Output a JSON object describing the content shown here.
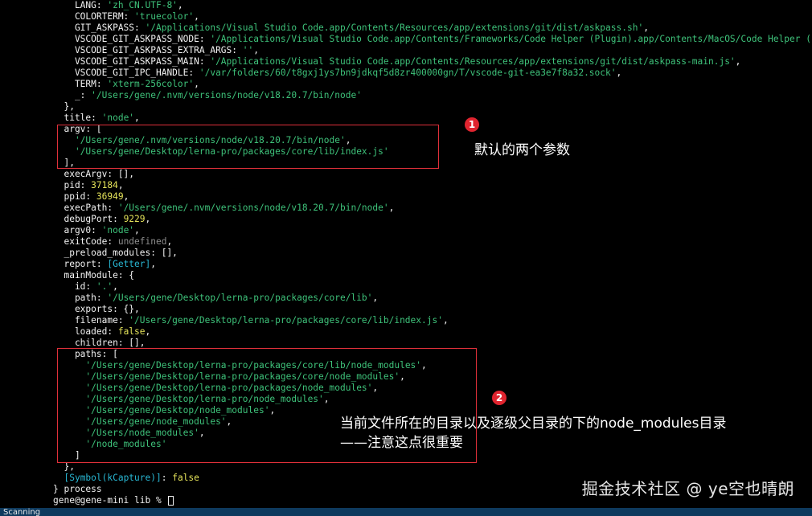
{
  "terminal": {
    "lines": [
      [
        {
          "t": "    LANG: ",
          "c": "k"
        },
        {
          "t": "'zh_CN.UTF-8'",
          "c": "s"
        },
        {
          "t": ",",
          "c": "p"
        }
      ],
      [
        {
          "t": "    COLORTERM: ",
          "c": "k"
        },
        {
          "t": "'truecolor'",
          "c": "s"
        },
        {
          "t": ",",
          "c": "p"
        }
      ],
      [
        {
          "t": "    GIT_ASKPASS: ",
          "c": "k"
        },
        {
          "t": "'/Applications/Visual Studio Code.app/Contents/Resources/app/extensions/git/dist/askpass.sh'",
          "c": "s"
        },
        {
          "t": ",",
          "c": "p"
        }
      ],
      [
        {
          "t": "    VSCODE_GIT_ASKPASS_NODE: ",
          "c": "k"
        },
        {
          "t": "'/Applications/Visual Studio Code.app/Contents/Frameworks/Code Helper (Plugin).app/Contents/MacOS/Code Helper (Plugin)'",
          "c": "s"
        },
        {
          "t": ",",
          "c": "p"
        }
      ],
      [
        {
          "t": "    VSCODE_GIT_ASKPASS_EXTRA_ARGS: ",
          "c": "k"
        },
        {
          "t": "''",
          "c": "s"
        },
        {
          "t": ",",
          "c": "p"
        }
      ],
      [
        {
          "t": "    VSCODE_GIT_ASKPASS_MAIN: ",
          "c": "k"
        },
        {
          "t": "'/Applications/Visual Studio Code.app/Contents/Resources/app/extensions/git/dist/askpass-main.js'",
          "c": "s"
        },
        {
          "t": ",",
          "c": "p"
        }
      ],
      [
        {
          "t": "    VSCODE_GIT_IPC_HANDLE: ",
          "c": "k"
        },
        {
          "t": "'/var/folders/60/t8gxj1ys7bn9jdkqf5d8zr400000gn/T/vscode-git-ea3e7f8a32.sock'",
          "c": "s"
        },
        {
          "t": ",",
          "c": "p"
        }
      ],
      [
        {
          "t": "    TERM: ",
          "c": "k"
        },
        {
          "t": "'xterm-256color'",
          "c": "s"
        },
        {
          "t": ",",
          "c": "p"
        }
      ],
      [
        {
          "t": "    _: ",
          "c": "k"
        },
        {
          "t": "'/Users/gene/.nvm/versions/node/v18.20.7/bin/node'",
          "c": "s"
        }
      ],
      [
        {
          "t": "  },",
          "c": "p"
        }
      ],
      [
        {
          "t": "  title: ",
          "c": "k"
        },
        {
          "t": "'node'",
          "c": "s"
        },
        {
          "t": ",",
          "c": "p"
        }
      ],
      [
        {
          "t": "  argv: [",
          "c": "k"
        }
      ],
      [
        {
          "t": "    ",
          "c": "p"
        },
        {
          "t": "'/Users/gene/.nvm/versions/node/v18.20.7/bin/node'",
          "c": "s"
        },
        {
          "t": ",",
          "c": "p"
        }
      ],
      [
        {
          "t": "    ",
          "c": "p"
        },
        {
          "t": "'/Users/gene/Desktop/lerna-pro/packages/core/lib/index.js'",
          "c": "s"
        }
      ],
      [
        {
          "t": "  ],",
          "c": "p"
        }
      ],
      [
        {
          "t": "  execArgv: [],",
          "c": "k"
        }
      ],
      [
        {
          "t": "  pid: ",
          "c": "k"
        },
        {
          "t": "37184",
          "c": "n"
        },
        {
          "t": ",",
          "c": "p"
        }
      ],
      [
        {
          "t": "  ppid: ",
          "c": "k"
        },
        {
          "t": "36949",
          "c": "n"
        },
        {
          "t": ",",
          "c": "p"
        }
      ],
      [
        {
          "t": "  execPath: ",
          "c": "k"
        },
        {
          "t": "'/Users/gene/.nvm/versions/node/v18.20.7/bin/node'",
          "c": "s"
        },
        {
          "t": ",",
          "c": "p"
        }
      ],
      [
        {
          "t": "  debugPort: ",
          "c": "k"
        },
        {
          "t": "9229",
          "c": "n"
        },
        {
          "t": ",",
          "c": "p"
        }
      ],
      [
        {
          "t": "  argv0: ",
          "c": "k"
        },
        {
          "t": "'node'",
          "c": "s"
        },
        {
          "t": ",",
          "c": "p"
        }
      ],
      [
        {
          "t": "  exitCode: ",
          "c": "k"
        },
        {
          "t": "undefined",
          "c": "u"
        },
        {
          "t": ",",
          "c": "p"
        }
      ],
      [
        {
          "t": "  _preload_modules: [],",
          "c": "k"
        }
      ],
      [
        {
          "t": "  report: ",
          "c": "k"
        },
        {
          "t": "[Getter]",
          "c": "c"
        },
        {
          "t": ",",
          "c": "p"
        }
      ],
      [
        {
          "t": "  mainModule: {",
          "c": "k"
        }
      ],
      [
        {
          "t": "    id: ",
          "c": "k"
        },
        {
          "t": "'.'",
          "c": "s"
        },
        {
          "t": ",",
          "c": "p"
        }
      ],
      [
        {
          "t": "    path: ",
          "c": "k"
        },
        {
          "t": "'/Users/gene/Desktop/lerna-pro/packages/core/lib'",
          "c": "s"
        },
        {
          "t": ",",
          "c": "p"
        }
      ],
      [
        {
          "t": "    exports: {},",
          "c": "k"
        }
      ],
      [
        {
          "t": "    filename: ",
          "c": "k"
        },
        {
          "t": "'/Users/gene/Desktop/lerna-pro/packages/core/lib/index.js'",
          "c": "s"
        },
        {
          "t": ",",
          "c": "p"
        }
      ],
      [
        {
          "t": "    loaded: ",
          "c": "k"
        },
        {
          "t": "false",
          "c": "n"
        },
        {
          "t": ",",
          "c": "p"
        }
      ],
      [
        {
          "t": "    children: [],",
          "c": "k"
        }
      ],
      [
        {
          "t": "    paths: [",
          "c": "k"
        }
      ],
      [
        {
          "t": "      ",
          "c": "p"
        },
        {
          "t": "'/Users/gene/Desktop/lerna-pro/packages/core/lib/node_modules'",
          "c": "s"
        },
        {
          "t": ",",
          "c": "p"
        }
      ],
      [
        {
          "t": "      ",
          "c": "p"
        },
        {
          "t": "'/Users/gene/Desktop/lerna-pro/packages/core/node_modules'",
          "c": "s"
        },
        {
          "t": ",",
          "c": "p"
        }
      ],
      [
        {
          "t": "      ",
          "c": "p"
        },
        {
          "t": "'/Users/gene/Desktop/lerna-pro/packages/node_modules'",
          "c": "s"
        },
        {
          "t": ",",
          "c": "p"
        }
      ],
      [
        {
          "t": "      ",
          "c": "p"
        },
        {
          "t": "'/Users/gene/Desktop/lerna-pro/node_modules'",
          "c": "s"
        },
        {
          "t": ",",
          "c": "p"
        }
      ],
      [
        {
          "t": "      ",
          "c": "p"
        },
        {
          "t": "'/Users/gene/Desktop/node_modules'",
          "c": "s"
        },
        {
          "t": ",",
          "c": "p"
        }
      ],
      [
        {
          "t": "      ",
          "c": "p"
        },
        {
          "t": "'/Users/gene/node_modules'",
          "c": "s"
        },
        {
          "t": ",",
          "c": "p"
        }
      ],
      [
        {
          "t": "      ",
          "c": "p"
        },
        {
          "t": "'/Users/node_modules'",
          "c": "s"
        },
        {
          "t": ",",
          "c": "p"
        }
      ],
      [
        {
          "t": "      ",
          "c": "p"
        },
        {
          "t": "'/node_modules'",
          "c": "s"
        }
      ],
      [
        {
          "t": "    ]",
          "c": "p"
        }
      ],
      [
        {
          "t": "  },",
          "c": "p"
        }
      ],
      [
        {
          "t": "  ",
          "c": "p"
        },
        {
          "t": "[Symbol(kCapture)]",
          "c": "c"
        },
        {
          "t": ": ",
          "c": "k"
        },
        {
          "t": "false",
          "c": "n"
        }
      ],
      [
        {
          "t": "} process",
          "c": "k"
        }
      ]
    ],
    "prompt": "gene@gene-mini lib % "
  },
  "annotations": {
    "badge1": "1",
    "note1": "默认的两个参数",
    "badge2": "2",
    "note2_line1": "当前文件所在的目录以及逐级父目录的下的node_modules目录",
    "note2_line2": "——注意这点很重要"
  },
  "watermark": "掘金技术社区 @ ye空也晴朗",
  "statusbar": {
    "text": "Scanning"
  }
}
